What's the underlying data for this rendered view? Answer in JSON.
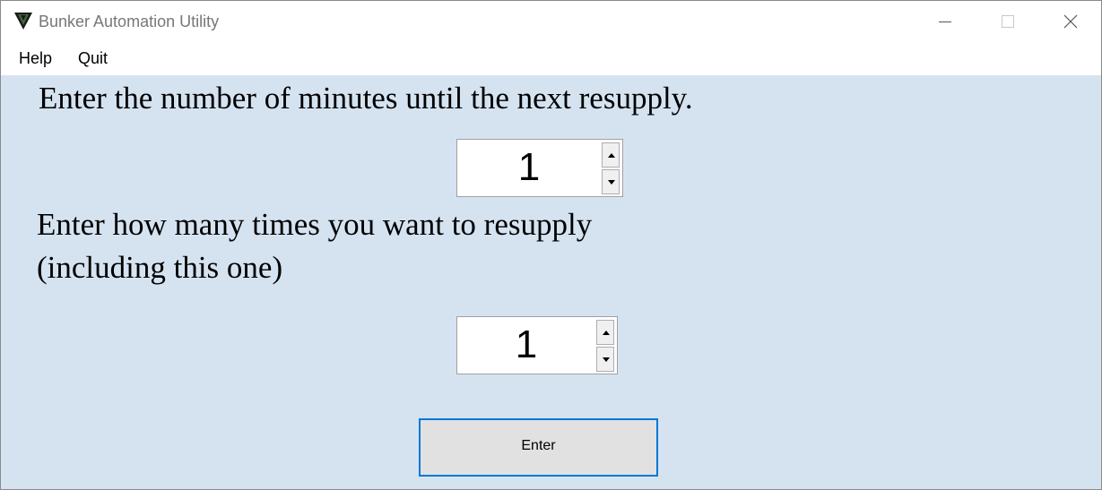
{
  "window": {
    "title": "Bunker Automation Utility",
    "icon": "app-logo-icon",
    "controls": [
      "minimize-icon",
      "maximize-icon",
      "close-icon"
    ]
  },
  "menu": {
    "items": [
      {
        "label": "Help"
      },
      {
        "label": "Quit"
      }
    ]
  },
  "form": {
    "minutes_label": "Enter the number of minutes until the next resupply.",
    "minutes_value": "1",
    "times_label_line1": "Enter how many times you want to resupply",
    "times_label_line2": "(including this one)",
    "times_value": "1",
    "enter_button": "Enter"
  },
  "colors": {
    "client_background": "#d5e3f1",
    "button_focus_border": "#0078d7",
    "button_face": "#e1e1e1"
  }
}
